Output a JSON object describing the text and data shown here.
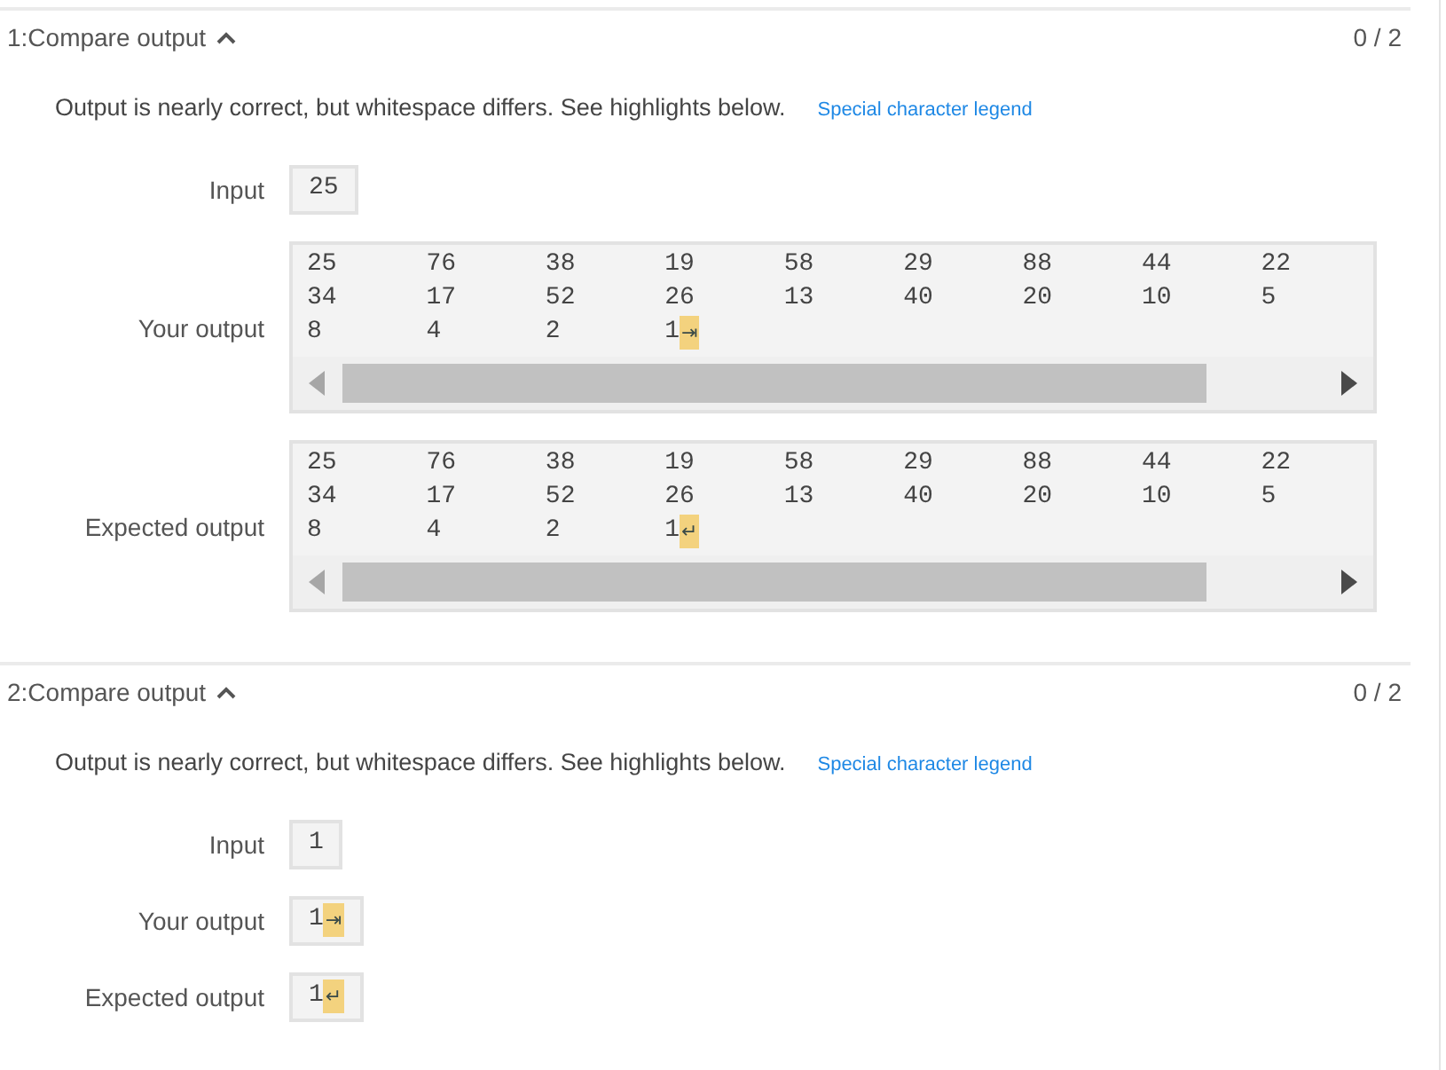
{
  "tests": [
    {
      "title": "1:Compare output",
      "expanded": true,
      "score": "0 / 2",
      "message": "Output is nearly correct, but whitespace differs. See highlights below.",
      "legend_link": "Special character legend",
      "fields": [
        {
          "label": "Input",
          "kind": "inline",
          "lines": [
            "25"
          ]
        },
        {
          "label": "Your output",
          "kind": "scrolling",
          "lines": [
            "25\t76\t38\t19\t58\t29\t88\t44\t22",
            "34\t17\t52\t26\t13\t40\t20\t10\t5",
            "8\t4\t2\t1"
          ],
          "marker": "⇥"
        },
        {
          "label": "Expected output",
          "kind": "scrolling",
          "lines": [
            "25\t76\t38\t19\t58\t29\t88\t44\t22",
            "34\t17\t52\t26\t13\t40\t20\t10\t5",
            "8\t4\t2\t1"
          ],
          "marker": "↵"
        }
      ]
    },
    {
      "title": "2:Compare output",
      "expanded": true,
      "score": "0 / 2",
      "message": "Output is nearly correct, but whitespace differs. See highlights below.",
      "legend_link": "Special character legend",
      "fields": [
        {
          "label": "Input",
          "kind": "inline",
          "lines": [
            "1"
          ]
        },
        {
          "label": "Your output",
          "kind": "inline",
          "lines": [
            "1"
          ],
          "marker": "⇥"
        },
        {
          "label": "Expected output",
          "kind": "inline",
          "lines": [
            "1"
          ],
          "marker": "↵"
        }
      ]
    }
  ]
}
